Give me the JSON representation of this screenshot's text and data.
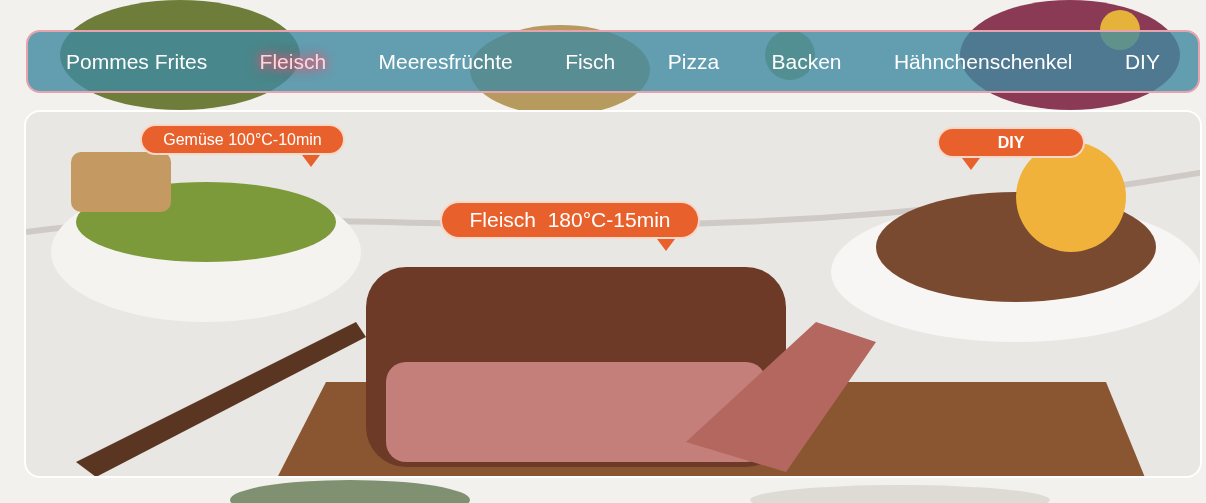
{
  "tabs": [
    {
      "label": "Pommes Frites",
      "selected": false
    },
    {
      "label": "Fleisch",
      "selected": true
    },
    {
      "label": "Meeresfrüchte",
      "selected": false
    },
    {
      "label": "Fisch",
      "selected": false
    },
    {
      "label": "Pizza",
      "selected": false
    },
    {
      "label": "Backen",
      "selected": false
    },
    {
      "label": "Hähnchenschenkel",
      "selected": false
    },
    {
      "label": "DIY",
      "selected": false
    }
  ],
  "callouts": [
    {
      "text": "Gemüse 100°C-10min",
      "kind": "tailright"
    },
    {
      "text": "Fleisch  180°C-15min",
      "kind": "tailright"
    },
    {
      "text": "DIY",
      "kind": "tailleft"
    }
  ]
}
